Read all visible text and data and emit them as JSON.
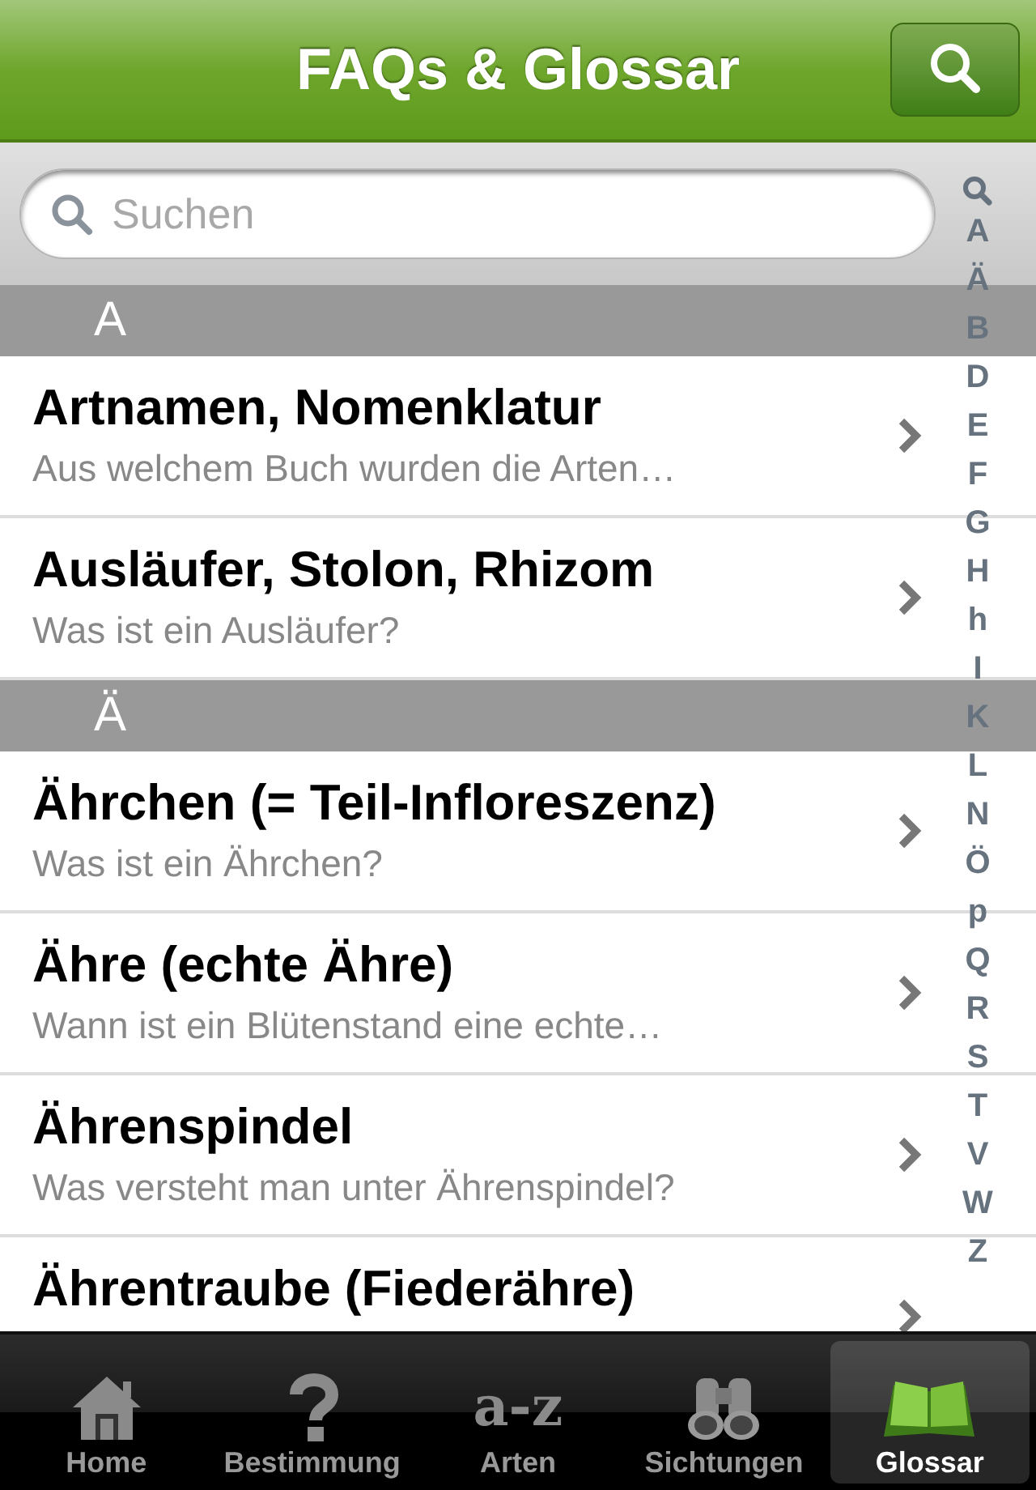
{
  "nav_bar": {
    "title": "FAQs & Glossar"
  },
  "search": {
    "placeholder": "Suchen"
  },
  "sections": [
    {
      "letter": "A",
      "rows": [
        {
          "title": "Artnamen, Nomenklatur",
          "subtitle": "Aus welchem Buch wurden die Arten…"
        },
        {
          "title": "Ausläufer, Stolon, Rhizom",
          "subtitle": "Was ist ein Ausläufer?"
        }
      ]
    },
    {
      "letter": "Ä",
      "rows": [
        {
          "title": "Ährchen (= Teil-Infloreszenz)",
          "subtitle": "Was ist ein Ährchen?"
        },
        {
          "title": "Ähre (echte Ähre)",
          "subtitle": "Wann ist ein Blütenstand eine echte…"
        },
        {
          "title": "Ährenspindel",
          "subtitle": "Was versteht man unter Ährenspindel?"
        },
        {
          "title": "Ährentraube (Fiederähre)"
        }
      ]
    }
  ],
  "index": [
    "A",
    "Ä",
    "B",
    "D",
    "E",
    "F",
    "G",
    "H",
    "h",
    "I",
    "K",
    "L",
    "N",
    "Ö",
    "p",
    "Q",
    "R",
    "S",
    "T",
    "V",
    "W",
    "Z"
  ],
  "tab_bar": [
    {
      "kind": "home",
      "label": "Home",
      "selected": false
    },
    {
      "kind": "question",
      "label": "Bestimmung",
      "selected": false
    },
    {
      "kind": "az",
      "label": "Arten",
      "icon_text": "a-z",
      "selected": false
    },
    {
      "kind": "binoculars",
      "label": "Sichtungen",
      "selected": false
    },
    {
      "kind": "book",
      "label": "Glossar",
      "selected": true
    }
  ]
}
